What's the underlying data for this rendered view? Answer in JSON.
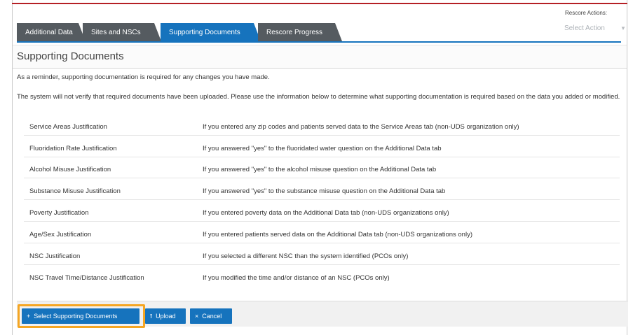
{
  "rescore": {
    "label": "Rescore Actions:",
    "select_value": "Select Action",
    "caret_icon": "chevron-down-icon"
  },
  "tabs": [
    {
      "label": "Additional Data",
      "active": false
    },
    {
      "label": "Sites and NSCs",
      "active": false
    },
    {
      "label": "Supporting Documents",
      "active": true
    },
    {
      "label": "Rescore Progress",
      "active": false
    }
  ],
  "page_title": "Supporting Documents",
  "reminder": "As a reminder, supporting documentation is required for any changes you have made.",
  "instructions": "The system will not verify that required documents have been uploaded.  Please use the information below to determine what supporting documentation is required based on the data you added or modified.",
  "documents": [
    {
      "name": "Service Areas Justification",
      "description": "If you entered any zip codes and patients served data to the Service Areas tab (non-UDS organization only)"
    },
    {
      "name": "Fluoridation Rate Justification",
      "description": "If you answered \"yes\" to the fluoridated water question on the Additional Data tab"
    },
    {
      "name": "Alcohol Misuse Justification",
      "description": "If you answered \"yes\" to the alcohol misuse question on the Additional Data tab"
    },
    {
      "name": "Substance Misuse Justification",
      "description": "If you answered \"yes\" to the substance misuse question on the Additional Data tab"
    },
    {
      "name": "Poverty Justification",
      "description": "If you entered poverty data on the Additional Data tab (non-UDS organizations only)"
    },
    {
      "name": "Age/Sex Justification",
      "description": "If you entered patients served data on the Additional Data tab (non-UDS organizations only)"
    },
    {
      "name": "NSC Justification",
      "description": "If you selected a different NSC than the system identified (PCOs only)"
    },
    {
      "name": "NSC Travel Time/Distance Justification",
      "description": "If you modified the time and/or distance of an NSC (PCOs only)"
    }
  ],
  "buttons": {
    "select": {
      "icon": "+",
      "label": "Select Supporting Documents"
    },
    "upload": {
      "icon": "⭱",
      "label": "Upload"
    },
    "cancel": {
      "icon": "×",
      "label": "Cancel"
    }
  },
  "colors": {
    "accent": "#1673bd",
    "tab_dark": "#555b60",
    "highlight": "#f5a623",
    "top_rule": "#b52025"
  }
}
